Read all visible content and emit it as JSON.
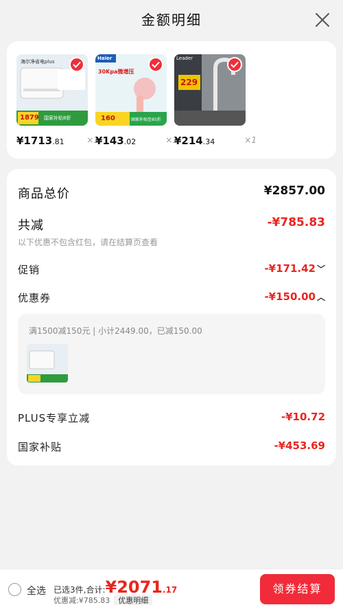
{
  "header": {
    "title": "金额明细"
  },
  "products": [
    {
      "price_int": "¥1713",
      "price_dec": ".81",
      "qty": "×1",
      "img_text": "海尔净省电plus",
      "img_sub": "1879",
      "img_tag": "国家补贴8折"
    },
    {
      "price_int": "¥143",
      "price_dec": ".02",
      "qty": "×1",
      "img_text": "30Kpa微增压",
      "img_sub": "160",
      "img_tag": "国家补贴至85折"
    },
    {
      "price_int": "¥214",
      "price_dec": ".34",
      "qty": "×1",
      "img_text": "Leader",
      "img_sub": "229",
      "img_tag": ""
    }
  ],
  "details": {
    "total_label": "商品总价",
    "total_value": "¥2857.00",
    "discount_label": "共减",
    "discount_value": "-¥785.83",
    "discount_note": "以下优惠不包含红包，请在结算页查看",
    "promo_label": "促销",
    "promo_value": "-¥171.42",
    "coupon_label": "优惠券",
    "coupon_value": "-¥150.00",
    "coupon_desc": "满1500减150元 | 小计2449.00，已减150.00",
    "plus_label": "PLUS专享立减",
    "plus_value": "-¥10.72",
    "subsidy_label": "国家补贴",
    "subsidy_value": "-¥453.69"
  },
  "footer": {
    "select_all": "全选",
    "summary_prefix": "已选3件,合计:",
    "total_int": "¥2071",
    "total_dec": ".17",
    "saved": "优惠减:¥785.83",
    "detail_link": "优惠明细",
    "checkout": "领券结算"
  },
  "colors": {
    "accent": "#e8261f",
    "button": "#f12b39"
  }
}
